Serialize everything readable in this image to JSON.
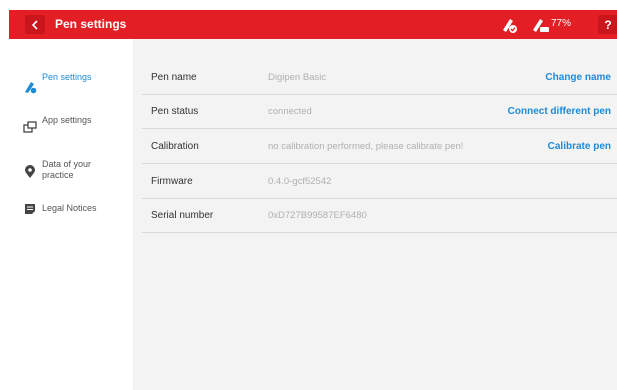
{
  "header": {
    "title": "Pen settings",
    "battery": "77%",
    "help_label": "?",
    "back_icon": "chevron-left-icon",
    "pen_status_icon": "pen-connected-icon",
    "pen_battery_icon": "pen-battery-icon",
    "color": "#e31e24"
  },
  "sidebar": {
    "items": [
      {
        "label": "Pen settings",
        "icon": "pen-icon",
        "active": true
      },
      {
        "label": "App settings",
        "icon": "tablet-icon",
        "active": false
      },
      {
        "label": "Data of your practice",
        "icon": "location-icon",
        "active": false
      },
      {
        "label": "Legal Notices",
        "icon": "document-icon",
        "active": false
      }
    ]
  },
  "rows": [
    {
      "label": "Pen name",
      "value": "Digipen Basic",
      "action": "Change name"
    },
    {
      "label": "Pen status",
      "value": "connected",
      "action": "Connect different pen"
    },
    {
      "label": "Calibration",
      "value": "no calibration performed, please calibrate pen!",
      "action": "Calibrate pen"
    },
    {
      "label": "Firmware",
      "value": "0.4.0-gcf52542",
      "action": ""
    },
    {
      "label": "Serial number",
      "value": "0xD727B99587EF6480",
      "action": ""
    }
  ],
  "colors": {
    "accent": "#1e8bd6",
    "brand": "#e31e24",
    "panel": "#f3f3f3"
  }
}
